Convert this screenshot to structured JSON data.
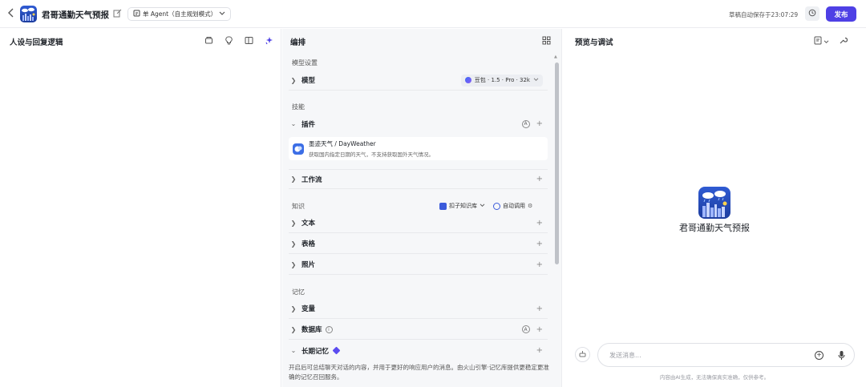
{
  "topbar": {
    "back_icon": "chevron-left-icon",
    "app_name": "君哥通勤天气预报",
    "mode_label": "单 Agent（自主规划模式）",
    "draft_status": "草稿自动保存于23:07:29",
    "publish_label": "发布"
  },
  "left_panel": {
    "title": "人设与回复逻辑",
    "icons": [
      "template-icon",
      "bulb-icon",
      "layout-icon",
      "sparkle-icon"
    ]
  },
  "mid_panel": {
    "title": "编排",
    "model_section": "模型设置",
    "model_row": "模型",
    "model_value": "豆包 · 1.5 · Pro · 32k",
    "skills_section": "技能",
    "plugins_row": "插件",
    "plugin": {
      "name": "墨迹天气 / DayWeather",
      "desc": "获取国内指定日期的天气，不支持获取国外天气情况。"
    },
    "workflow_row": "工作流",
    "knowledge_section": "知识",
    "kb_button": "扣子知识库",
    "auto_call": "自动调用",
    "text_row": "文本",
    "table_row": "表格",
    "photo_row": "照片",
    "memory_section": "记忆",
    "variables_row": "变量",
    "database_row": "数据库",
    "ltm_row": "长期记忆",
    "ltm_desc": "开启后可总结聊天对话的内容，并用于更好的响应用户的消息。由火山引擎·记忆库提供更稳定更准确的记忆召回服务。",
    "plus": "+",
    "a_badge": "A"
  },
  "right_panel": {
    "title": "预览与调试",
    "bot_name": "君哥通勤天气预报",
    "input_placeholder": "发送消息...",
    "disclaimer": "内容由AI生成，无法确保真实准确，仅供参考。"
  },
  "colors": {
    "accent": "#4e40e5",
    "logo_bg": "#2f5bd3"
  }
}
